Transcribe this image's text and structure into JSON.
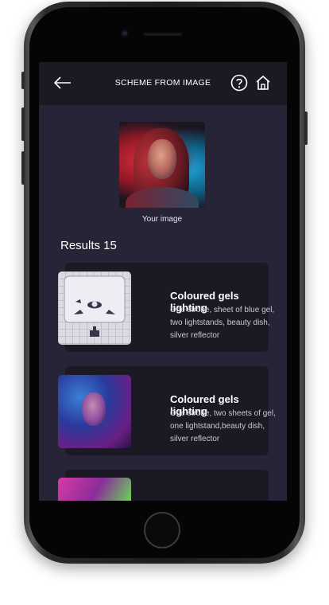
{
  "header": {
    "title": "SCHEME FROM IMAGE",
    "back_icon": "arrow-left-icon",
    "help_icon": "question-circle-icon",
    "home_icon": "home-icon"
  },
  "upload": {
    "caption": "Your image"
  },
  "results": {
    "label": "Results 15",
    "items": [
      {
        "title": "Coloured gels lighting",
        "description": "One strobe, sheet of blue gel, two lightstands, beauty dish, silver reflector"
      },
      {
        "title": "Coloured gels lighting",
        "description": "One strobe, two sheets of gel, one lightstand,beauty dish, silver reflector"
      },
      {
        "title": "",
        "description": ""
      }
    ]
  },
  "colors": {
    "screen_bg": "#262436",
    "card_bg": "#1b1a24",
    "text_primary": "#ffffff"
  }
}
